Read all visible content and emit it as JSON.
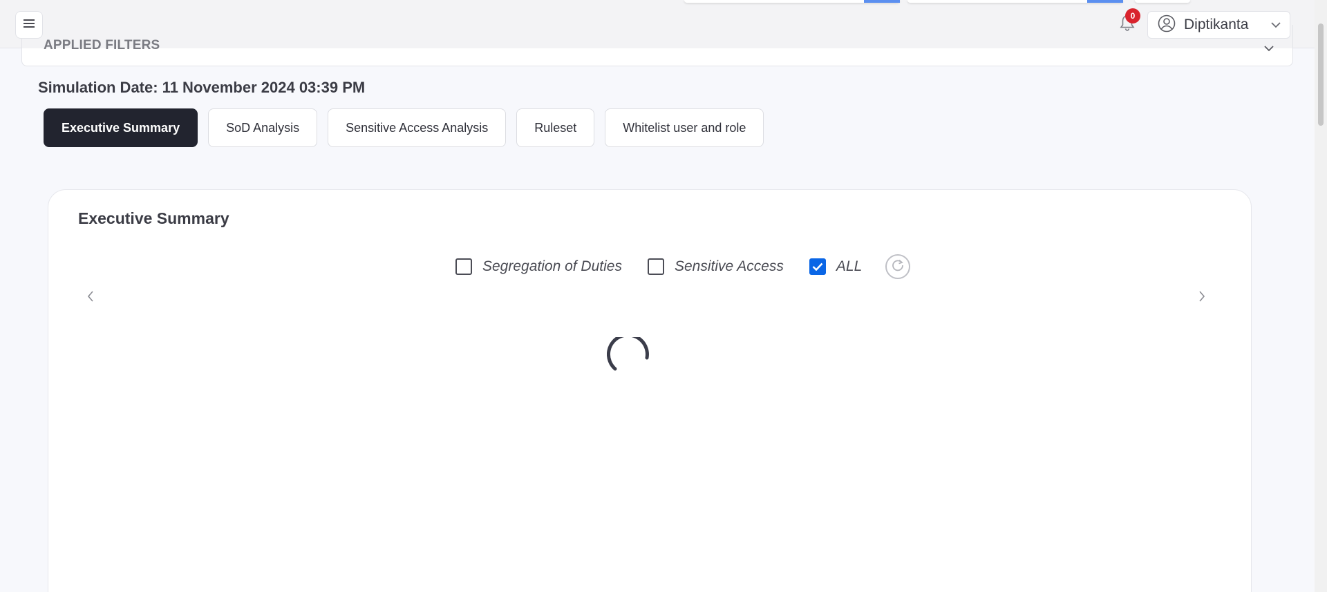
{
  "header": {
    "notifications_count": "0",
    "user_name": "Diptikanta"
  },
  "filters": {
    "title": "APPLIED FILTERS"
  },
  "simulation": {
    "date_text": "Simulation Date: 11 November 2024 03:39 PM"
  },
  "tabs": [
    {
      "label": "Executive Summary",
      "active": true
    },
    {
      "label": "SoD Analysis",
      "active": false
    },
    {
      "label": "Sensitive Access Analysis",
      "active": false
    },
    {
      "label": "Ruleset",
      "active": false
    },
    {
      "label": "Whitelist user and role",
      "active": false
    }
  ],
  "summary": {
    "title": "Executive Summary",
    "filters": [
      {
        "label": "Segregation of Duties",
        "checked": false
      },
      {
        "label": "Sensitive Access",
        "checked": false
      },
      {
        "label": "ALL",
        "checked": true
      }
    ]
  },
  "colors": {
    "accent": "#0a66e6",
    "active_tab": "#22242f",
    "badge": "#d9232d",
    "page_bg": "#f7f8fc"
  },
  "icons": [
    "menu-icon",
    "bell-icon",
    "user-circle-icon",
    "chevron-down-icon",
    "refresh-icon",
    "chevron-left-icon",
    "chevron-right-icon",
    "loading-spinner"
  ]
}
